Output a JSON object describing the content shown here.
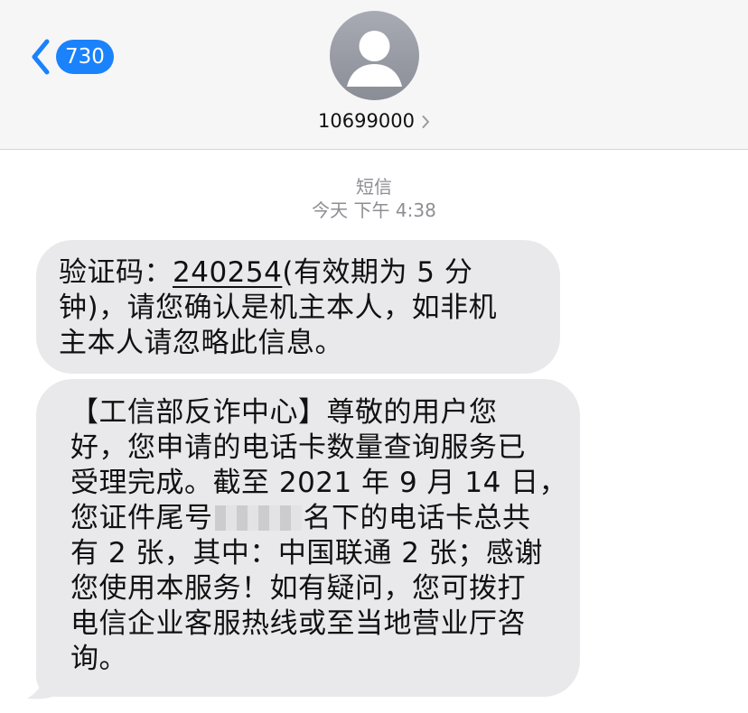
{
  "header": {
    "back_count": "730",
    "contact_name": "10699000",
    "icons": {
      "back": "chevron-left-icon",
      "avatar": "person-icon",
      "contact_disclosure": "chevron-right-icon"
    },
    "colors": {
      "accent": "#1a82fb",
      "header_bg": "#f6f6f6"
    }
  },
  "thread": {
    "service_label": "短信",
    "timestamp": "今天 下午 4:38",
    "messages": [
      {
        "lines": [
          {
            "prefix": "验证码：",
            "code": "240254",
            "suffix": "(有效期为 5 分"
          },
          {
            "text": "钟)，请您确认是机主本人，如非机"
          },
          {
            "text": "主本人请忽略此信息。"
          }
        ]
      },
      {
        "lines": [
          {
            "text": "【工信部反诈中心】尊敬的用户您"
          },
          {
            "text": "好，您申请的电话卡数量查询服务已"
          },
          {
            "text": "受理完成。截至 2021 年 9 月 14 日，"
          },
          {
            "prefix": "您证件尾号",
            "suffix": "名下的电话卡总共"
          },
          {
            "text": "有 2 张，其中：中国联通 2 张；感谢"
          },
          {
            "text": "您使用本服务！如有疑问，您可拨打"
          },
          {
            "text": "电信企业客服热线或至当地营业厅咨"
          },
          {
            "text": "询。"
          }
        ]
      }
    ],
    "colors": {
      "bubble_bg": "#e9e9eb",
      "meta_text": "#8e8e93"
    }
  }
}
